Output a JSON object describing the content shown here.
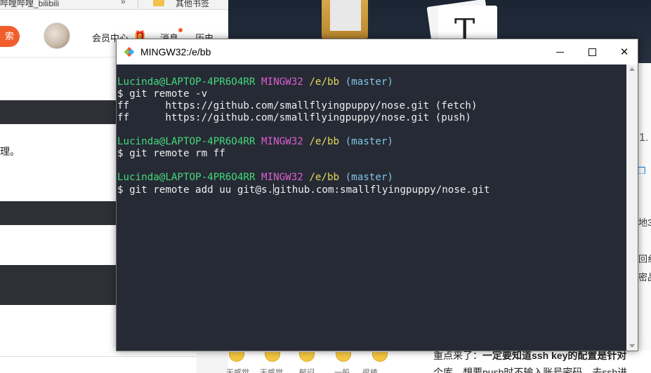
{
  "colors": {
    "terminal_bg": "#262a35",
    "prompt_user": "#44d97b",
    "prompt_system": "#d95fce",
    "prompt_path": "#e5d75c",
    "prompt_branch": "#7fc4e4",
    "terminal_text": "#eeeeee",
    "accent_orange": "#f25d2c"
  },
  "background": {
    "left_browser": {
      "tab_title": "哔哩哔哩_bilibili",
      "tab_overflow": "»",
      "bookmark_label": "其他书签",
      "search_button": "索",
      "member_center": "会员中心",
      "messages": "消息",
      "history": "历史",
      "body_text": "理。"
    },
    "desktop": {
      "card_letter": "T"
    },
    "right_article": {
      "cut_heading": "1.",
      "cut_line_1": "地3",
      "cut_line_2": "回纟",
      "cut_line_3": "密品",
      "emoji_captions": [
        "无感觉",
        "无感觉",
        "郁闷",
        "一般",
        "很棒"
      ],
      "highlight_prefix": "重点来了：",
      "highlight_bold": "一定要知道ssh key的配置是针对",
      "line_2": "个库，想要push时不输入账号密码，去ssh进"
    }
  },
  "window": {
    "title": "MINGW32:/e/bb",
    "icon": "git-bash-icon",
    "controls": {
      "minimize": "minimize-icon",
      "maximize": "maximize-icon",
      "close": "close-icon",
      "close_glyph": "✕"
    }
  },
  "terminal": {
    "prompt": {
      "user": "Lucinda@LAPTOP-4PR6O4RR",
      "system": "MINGW32",
      "path": "/e/bb",
      "branch": "(master)"
    },
    "lines": [
      "$ git remote -v",
      "ff      https://github.com/smallflyingpuppy/nose.git (fetch)",
      "ff      https://github.com/smallflyingpuppy/nose.git (push)",
      "$ git remote rm ff",
      "$ git remote add uu git@s.",
      "github.com:smallflyingpuppy/nose.git"
    ]
  }
}
